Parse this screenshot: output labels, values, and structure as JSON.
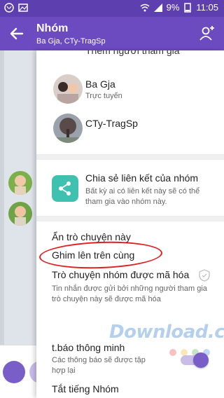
{
  "status_bar": {
    "battery": "9%",
    "time": "11:05"
  },
  "toolbar": {
    "title": "Nhóm",
    "subtitle": "Ba Gja, CTy-TragSp"
  },
  "top_row_partial": "Thêm người tham gia",
  "members": [
    {
      "name": "Ba Gja",
      "status": "Trực tuyến"
    },
    {
      "name": "CTy-TragSp",
      "status": ""
    }
  ],
  "share_link": {
    "title": "Chia sẻ liên kết của nhóm",
    "description": "Bất kỳ ai có liên kết này sẽ có thể tham gia vào nhóm này."
  },
  "menu": {
    "hide_chat": "Ẩn trò chuyện này",
    "pin_top": "Ghim lên trên cùng"
  },
  "encryption": {
    "title": "Trò chuyện nhóm được mã hóa",
    "description": "Tin nhắn được gửi bởi những người tham gia trò chuyện này sẽ được mã hóa"
  },
  "smart_notifications": {
    "title": "t.báo thông minh",
    "description": "Các thông báo sẽ được tập hợp lại",
    "enabled": true
  },
  "mute": {
    "title": "Tắt tiếng Nhóm"
  },
  "watermark": {
    "text": "Download.com.vn"
  },
  "colors": {
    "accent": "#6c4bc1",
    "share_tile": "#3fc1b0",
    "highlight": "#e02020"
  }
}
